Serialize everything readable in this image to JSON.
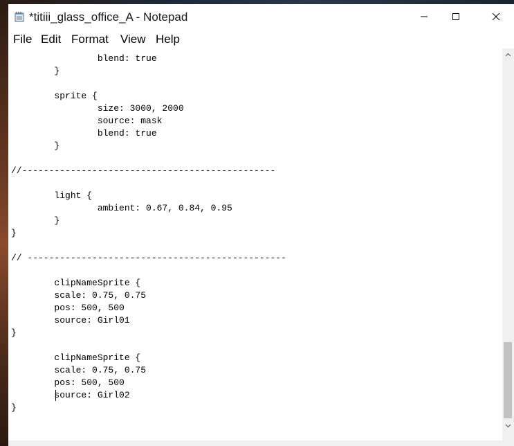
{
  "window": {
    "title": "*titiii_glass_office_A - Notepad",
    "controls": {
      "minimize_icon": "minimize-icon",
      "maximize_icon": "maximize-icon",
      "close_icon": "close-icon"
    }
  },
  "menu": {
    "items": [
      {
        "label": "File"
      },
      {
        "label": "Edit"
      },
      {
        "label": "Format"
      },
      {
        "label": "View"
      },
      {
        "label": "Help"
      }
    ]
  },
  "editor": {
    "lines": [
      "\t\tblend: true",
      "\t}",
      "",
      "\tsprite {",
      "\t\tsize: 3000, 2000",
      "\t\tsource: mask",
      "\t\tblend: true",
      "\t}",
      "",
      "//-----------------------------------------------",
      "",
      "\tlight {",
      "\t\tambient: 0.67, 0.84, 0.95",
      "\t}",
      "}",
      "",
      "// ------------------------------------------------",
      "",
      "\tclipNameSprite {",
      "\tscale: 0.75, 0.75",
      "\tpos: 500, 500",
      "\tsource: Girl01",
      "}",
      "",
      "\tclipNameSprite {",
      "\tscale: 0.75, 0.75",
      "\tpos: 500, 500",
      "\tsource: Girl02",
      "}"
    ]
  },
  "colors": {
    "window_bg": "#ffffff",
    "scrollbar_track": "#f0f0f0",
    "scrollbar_thumb": "#c2c2c2"
  }
}
